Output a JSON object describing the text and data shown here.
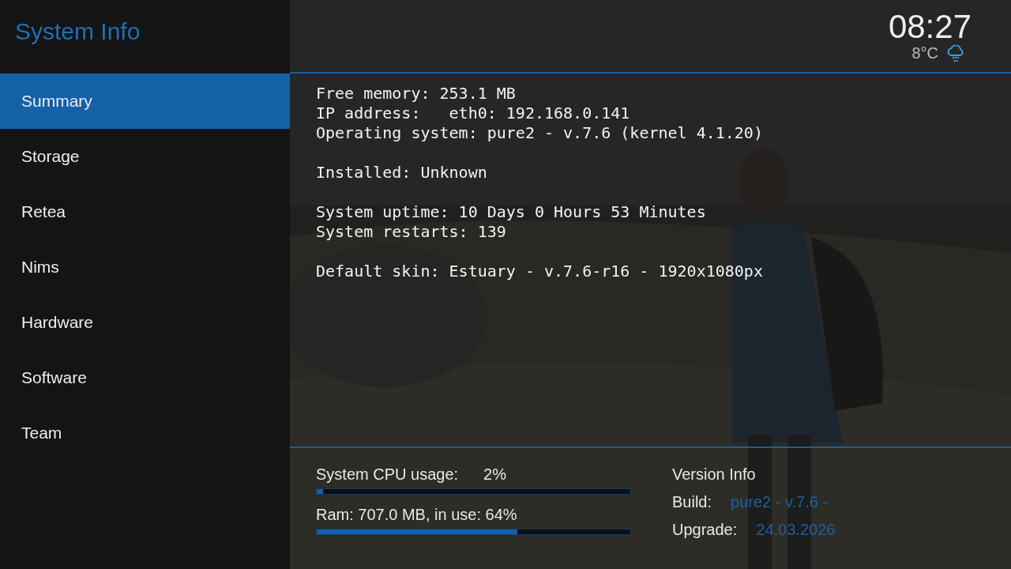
{
  "sidebar": {
    "title": "System Info",
    "items": [
      {
        "label": "Summary",
        "selected": true
      },
      {
        "label": "Storage",
        "selected": false
      },
      {
        "label": "Retea",
        "selected": false
      },
      {
        "label": "Nims",
        "selected": false
      },
      {
        "label": "Hardware",
        "selected": false
      },
      {
        "label": "Software",
        "selected": false
      },
      {
        "label": "Team",
        "selected": false
      }
    ]
  },
  "header": {
    "time": "08:27",
    "temperature": "8°C"
  },
  "info_groups": [
    [
      "Free memory: 253.1 MB",
      "IP address:   eth0: 192.168.0.141",
      "Operating system: pure2 - v.7.6 (kernel 4.1.20)"
    ],
    [
      "Installed: Unknown"
    ],
    [
      "System uptime: 10 Days 0 Hours 53 Minutes",
      "System restarts: 139"
    ],
    [
      "Default skin: Estuary - v.7.6-r16 - 1920x1080px"
    ]
  ],
  "meters": [
    {
      "label": "System CPU usage:",
      "reading": "2%",
      "level": 0.02
    },
    {
      "label": "Ram: 707.0 MB, in use: 64%",
      "level": 0.64
    }
  ],
  "version_info": {
    "title": "Version Info",
    "rows": [
      {
        "label": "Build:",
        "value": "pure2 - v.7.6 -"
      },
      {
        "label": "Upgrade:",
        "value": "24.03.2026"
      }
    ]
  }
}
